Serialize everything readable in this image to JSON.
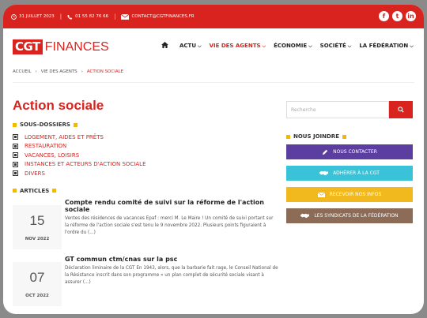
{
  "topbar": {
    "date": "31 JUILLET 2023",
    "phone": "01 55 82 76 66",
    "email": "CONTACT@CGTFINANCES.FR",
    "social": [
      "f",
      "t",
      "in"
    ]
  },
  "logo": {
    "cgt": "CGT",
    "finances": "FINANCES"
  },
  "nav": {
    "home_icon": "home-icon",
    "items": [
      "ACTU",
      "VIE DES AGENTS",
      "ÉCONOMIE",
      "SOCIÉTÉ",
      "LA FÉDÉRATION"
    ],
    "active": "VIE DES AGENTS"
  },
  "breadcrumb": [
    "ACCUEIL",
    "VIE DES AGENTS",
    "ACTION SOCIALE"
  ],
  "page_title": "Action sociale",
  "subfolders": {
    "heading": "SOUS-DOSSIERS",
    "items": [
      "LOGEMENT, AIDES ET PRÊTS",
      "RESTAURATION",
      "VACANCES, LOISIRS",
      "INSTANCES ET ACTEURS D'ACTION SOCIALE",
      "DIVERS"
    ]
  },
  "articles": {
    "heading": "ARTICLES",
    "items": [
      {
        "day": "15",
        "month": "NOV 2022",
        "title": "Compte rendu comité de suivi sur la réforme de l'action sociale",
        "excerpt": "Ventes des résidences de vacances Epaf : merci M. Le Maire ! Un comité de suivi portant sur la réforme de l'action sociale s'est tenu le 9 novembre 2022. Plusieurs points figuraient à l'ordre du (...)"
      },
      {
        "day": "07",
        "month": "OCT 2022",
        "title": "GT commun ctm/cnas sur la psc",
        "excerpt": "Déclaration liminaire de la CGT En 1943, alors, que la barbarie fait rage, le Conseil National de la Résistance inscrit dans son programme « un plan complet de sécurité sociale visant à assurer (...)"
      }
    ]
  },
  "sidebar": {
    "search_placeholder": "Recherche",
    "join_heading": "NOUS JOINDRE",
    "buttons": [
      {
        "label": "NOUS CONTACTER",
        "icon": "pencil-icon",
        "color": "#5b3e9f"
      },
      {
        "label": "ADHÉRER À LA CGT",
        "icon": "handshake-icon",
        "color": "#3ac3d8"
      },
      {
        "label": "RECEVOIR NOS INFOS",
        "icon": "envelope-icon",
        "color": "#f2b91e"
      },
      {
        "label": "LES SYNDICATS DE LA FÉDÉRATION",
        "icon": "handshake-icon",
        "color": "#8c6b57"
      }
    ]
  },
  "colors": {
    "brand_red": "#d8231f",
    "accent_yellow": "#f5b800"
  }
}
